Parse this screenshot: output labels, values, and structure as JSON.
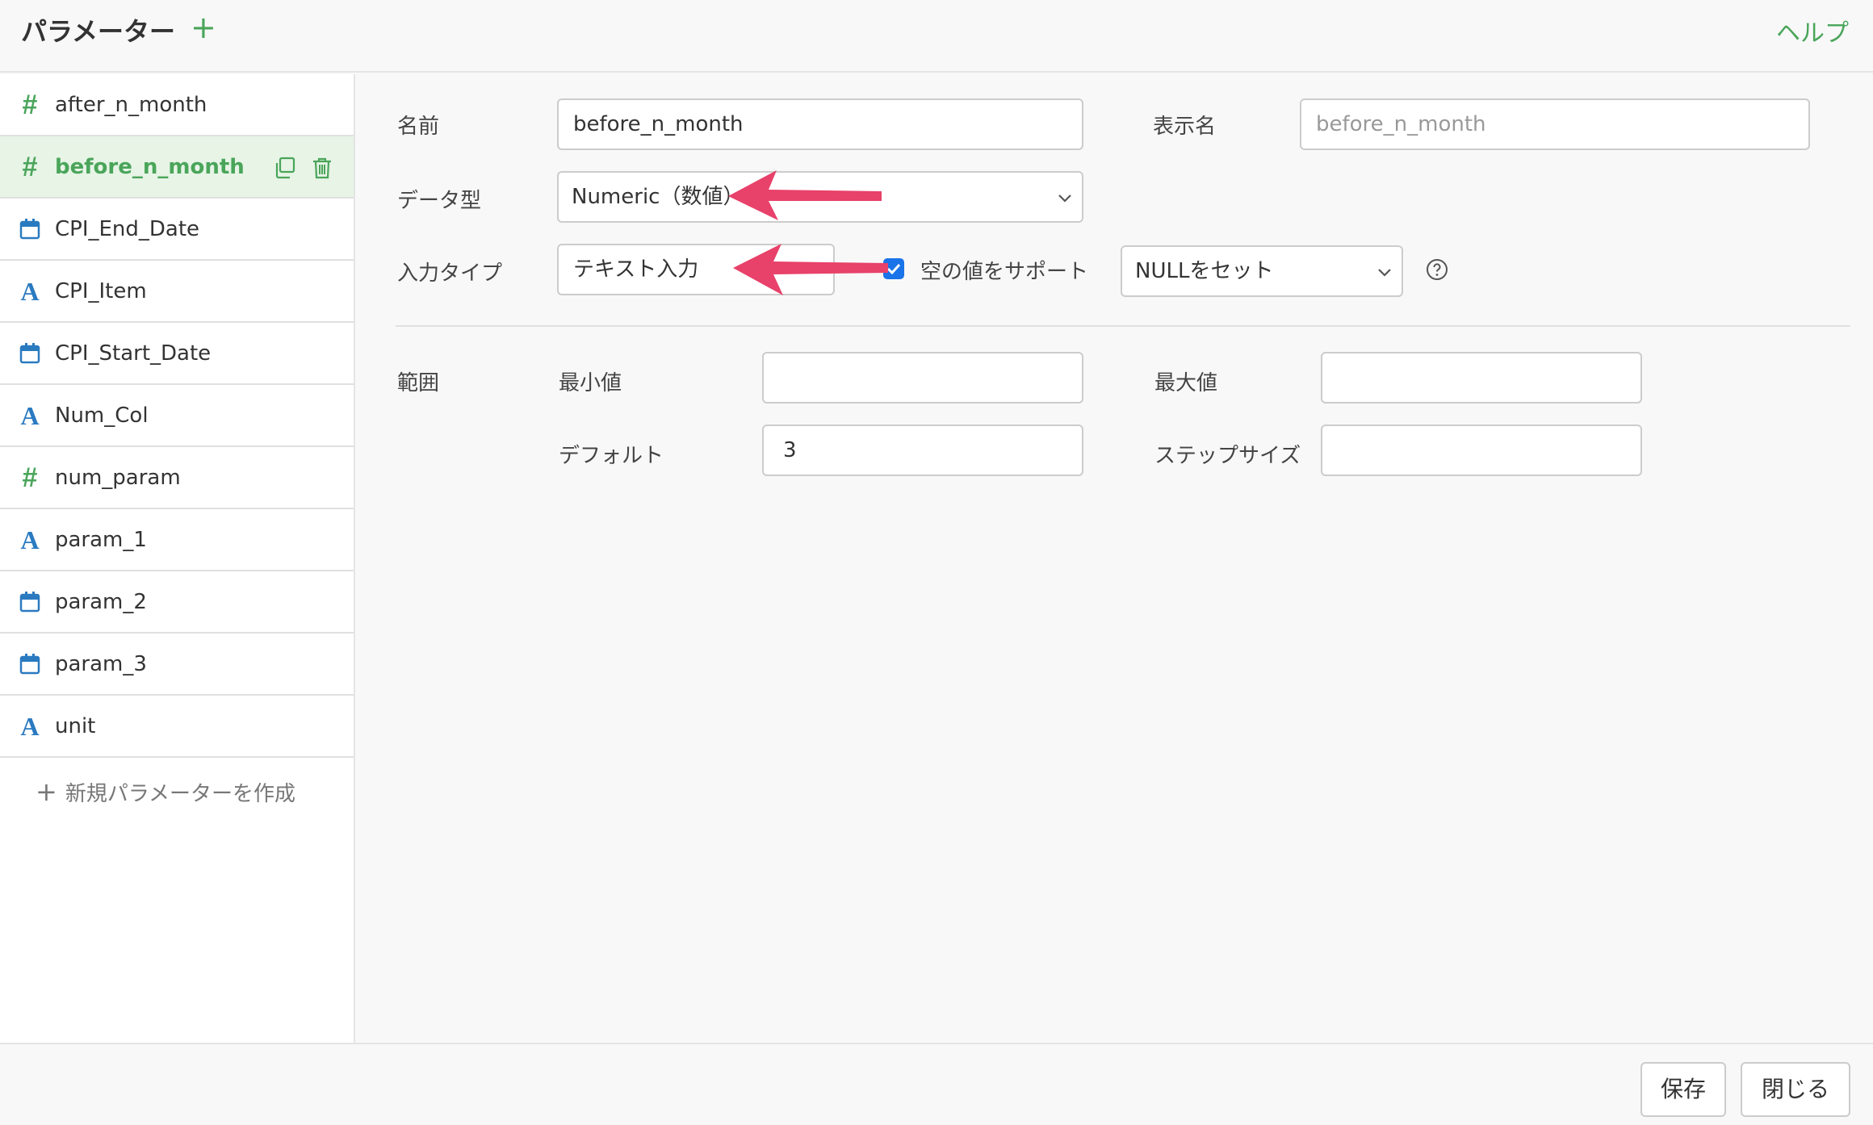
{
  "header": {
    "title": "パラメーター",
    "add_icon": "plus-icon",
    "help": "ヘルプ"
  },
  "sidebar": {
    "items": [
      {
        "icon": "hash-icon",
        "label": "after_n_month"
      },
      {
        "icon": "hash-icon",
        "label": "before_n_month",
        "selected": true
      },
      {
        "icon": "calendar-icon",
        "label": "CPI_End_Date"
      },
      {
        "icon": "text-type-icon",
        "label": "CPI_Item"
      },
      {
        "icon": "calendar-icon",
        "label": "CPI_Start_Date"
      },
      {
        "icon": "text-type-icon",
        "label": "Num_Col"
      },
      {
        "icon": "hash-icon",
        "label": "num_param"
      },
      {
        "icon": "text-type-icon",
        "label": "param_1"
      },
      {
        "icon": "calendar-icon",
        "label": "param_2"
      },
      {
        "icon": "calendar-icon",
        "label": "param_3"
      },
      {
        "icon": "text-type-icon",
        "label": "unit"
      }
    ],
    "new_param": "新規パラメーターを作成"
  },
  "form": {
    "name_label": "名前",
    "name_value": "before_n_month",
    "display_name_label": "表示名",
    "display_name_placeholder": "before_n_month",
    "data_type_label": "データ型",
    "data_type_value": "Numeric（数値）",
    "input_type_label": "入力タイプ",
    "input_type_value": "テキスト入力",
    "empty_support_label": "空の値をサポート",
    "empty_support_checked": true,
    "null_option_value": "NULLをセット",
    "range_label": "範囲",
    "min_label": "最小値",
    "min_value": "",
    "max_label": "最大値",
    "max_value": "",
    "default_label": "デフォルト",
    "default_value": "3",
    "step_label": "ステップサイズ",
    "step_value": ""
  },
  "footer": {
    "save": "保存",
    "close": "閉じる"
  },
  "colors": {
    "accent_green": "#4aa55a",
    "annotation_arrow": "#e8416a",
    "checkbox_blue": "#1a73e8",
    "type_icon_blue": "#2a7ac0"
  }
}
